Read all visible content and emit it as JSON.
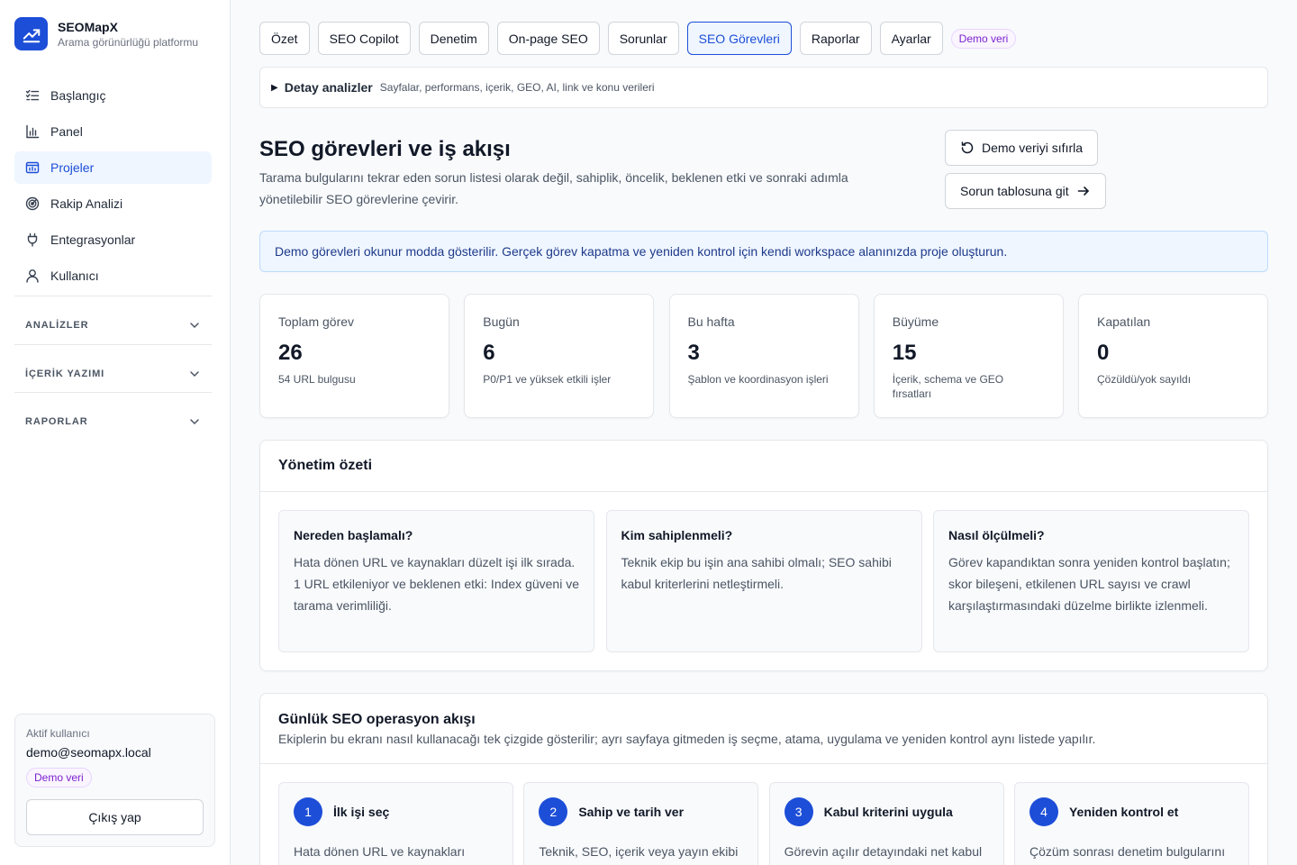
{
  "brand": {
    "name": "SEOMapX",
    "subtitle": "Arama görünürlüğü platformu"
  },
  "nav": [
    {
      "label": "Başlangıç",
      "icon": "checklist-icon"
    },
    {
      "label": "Panel",
      "icon": "bar-chart-icon"
    },
    {
      "label": "Projeler",
      "icon": "folder-chart-icon",
      "active": true
    },
    {
      "label": "Rakip Analizi",
      "icon": "radar-icon"
    },
    {
      "label": "Entegrasyonlar",
      "icon": "plug-icon"
    },
    {
      "label": "Kullanıcı",
      "icon": "user-icon"
    }
  ],
  "sections": [
    "ANALİZLER",
    "İÇERİK YAZIMI",
    "RAPORLAR"
  ],
  "user": {
    "label": "Aktif kullanıcı",
    "email": "demo@seomapx.local",
    "badge": "Demo veri",
    "logout": "Çıkış yap"
  },
  "tabs": [
    "Özet",
    "SEO Copilot",
    "Denetim",
    "On-page SEO",
    "Sorunlar",
    "SEO Görevleri",
    "Raporlar",
    "Ayarlar"
  ],
  "tabs_badge": "Demo veri",
  "details": {
    "title": "Detay analizler",
    "subtitle": "Sayfalar, performans, içerik, GEO, AI, link ve konu verileri"
  },
  "page": {
    "title": "SEO görevleri ve iş akışı",
    "description": "Tarama bulgularını tekrar eden sorun listesi olarak değil, sahiplik, öncelik, beklenen etki ve sonraki adımla yönetilebilir SEO görevlerine çevirir.",
    "reset_button": "Demo veriyi sıfırla",
    "issues_button": "Sorun tablosuna git"
  },
  "notice": "Demo görevleri okunur modda gösterilir. Gerçek görev kapatma ve yeniden kontrol için kendi workspace alanınızda proje oluşturun.",
  "stats": [
    {
      "label": "Toplam görev",
      "value": "26",
      "sub": "54 URL bulgusu"
    },
    {
      "label": "Bugün",
      "value": "6",
      "sub": "P0/P1 ve yüksek etkili işler"
    },
    {
      "label": "Bu hafta",
      "value": "3",
      "sub": "Şablon ve koordinasyon işleri"
    },
    {
      "label": "Büyüme",
      "value": "15",
      "sub": "İçerik, schema ve GEO fırsatları"
    },
    {
      "label": "Kapatılan",
      "value": "0",
      "sub": "Çözüldü/yok sayıldı"
    }
  ],
  "summary": {
    "title": "Yönetim özeti",
    "cards": [
      {
        "title": "Nereden başlamalı?",
        "text": "Hata dönen URL ve kaynakları düzelt işi ilk sırada. 1 URL etkileniyor ve beklenen etki: Index güveni ve tarama verimliliği."
      },
      {
        "title": "Kim sahiplenmeli?",
        "text": "Teknik ekip bu işin ana sahibi olmalı; SEO sahibi kabul kriterlerini netleştirmeli."
      },
      {
        "title": "Nasıl ölçülmeli?",
        "text": "Görev kapandıktan sonra yeniden kontrol başlatın; skor bileşeni, etkilenen URL sayısı ve crawl karşılaştırmasındaki düzelme birlikte izlenmeli."
      }
    ]
  },
  "flow": {
    "title": "Günlük SEO operasyon akışı",
    "subtitle": "Ekiplerin bu ekranı nasıl kullanacağı tek çizgide gösterilir; ayrı sayfaya gitmeden iş seçme, atama, uygulama ve yeniden kontrol aynı listede yapılır.",
    "steps": [
      {
        "num": "1",
        "title": "İlk işi seç",
        "text": "Hata dönen URL ve kaynakları düzelt işini seçin."
      },
      {
        "num": "2",
        "title": "Sahip ve tarih ver",
        "text": "Teknik, SEO, içerik veya yayın ekibi belirleyin ve tarih verin."
      },
      {
        "num": "3",
        "title": "Kabul kriterini uygula",
        "text": "Görevin açılır detayındaki net kabul kriterini uygulayın."
      },
      {
        "num": "4",
        "title": "Yeniden kontrol et",
        "text": "Çözüm sonrası denetim bulgularını yeniden kontrol edin."
      }
    ]
  },
  "colors": {
    "primary": "#1d4ed8",
    "primary_bg": "#eff6ff",
    "badge_purple": "#7e22ce"
  }
}
